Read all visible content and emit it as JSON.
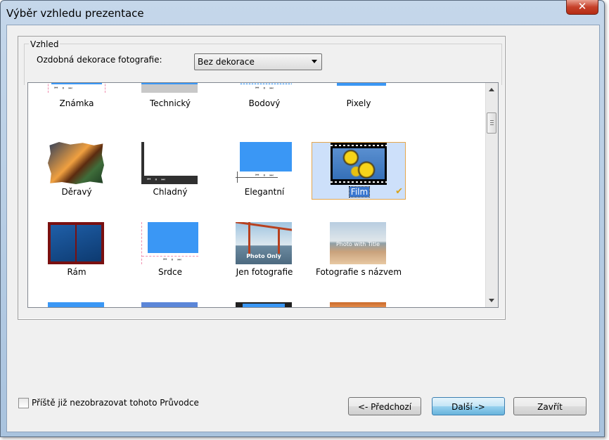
{
  "window": {
    "title": "Výběr vzhledu prezentace",
    "close_label": "✕"
  },
  "group": {
    "label": "Vzhled"
  },
  "decoration": {
    "label": "Ozdobná dekorace fotografie:",
    "selected": "Bez dekorace"
  },
  "styles": [
    {
      "label": "Známka"
    },
    {
      "label": "Technický"
    },
    {
      "label": "Bodový"
    },
    {
      "label": "Pixely"
    },
    {
      "label": "Děravý"
    },
    {
      "label": "Chladný"
    },
    {
      "label": "Elegantní"
    },
    {
      "label": "Film",
      "selected": true
    },
    {
      "label": "Rám"
    },
    {
      "label": "Srdce"
    },
    {
      "label": "Jen fotografie",
      "thumb_text": "Photo Only"
    },
    {
      "label": "Fotografie s názvem",
      "thumb_text": "Photo with Title"
    }
  ],
  "player_controls": "⏮ ⏸ ⏭",
  "footer": {
    "checkbox_label": "Příště již nezobrazovat tohoto Průvodce",
    "prev_label": "<- Předchozí",
    "next_label": "Další ->",
    "close_label": "Zavřít"
  },
  "colors": {
    "accent_blue": "#3a97f5",
    "selection": "#cde0fa"
  }
}
